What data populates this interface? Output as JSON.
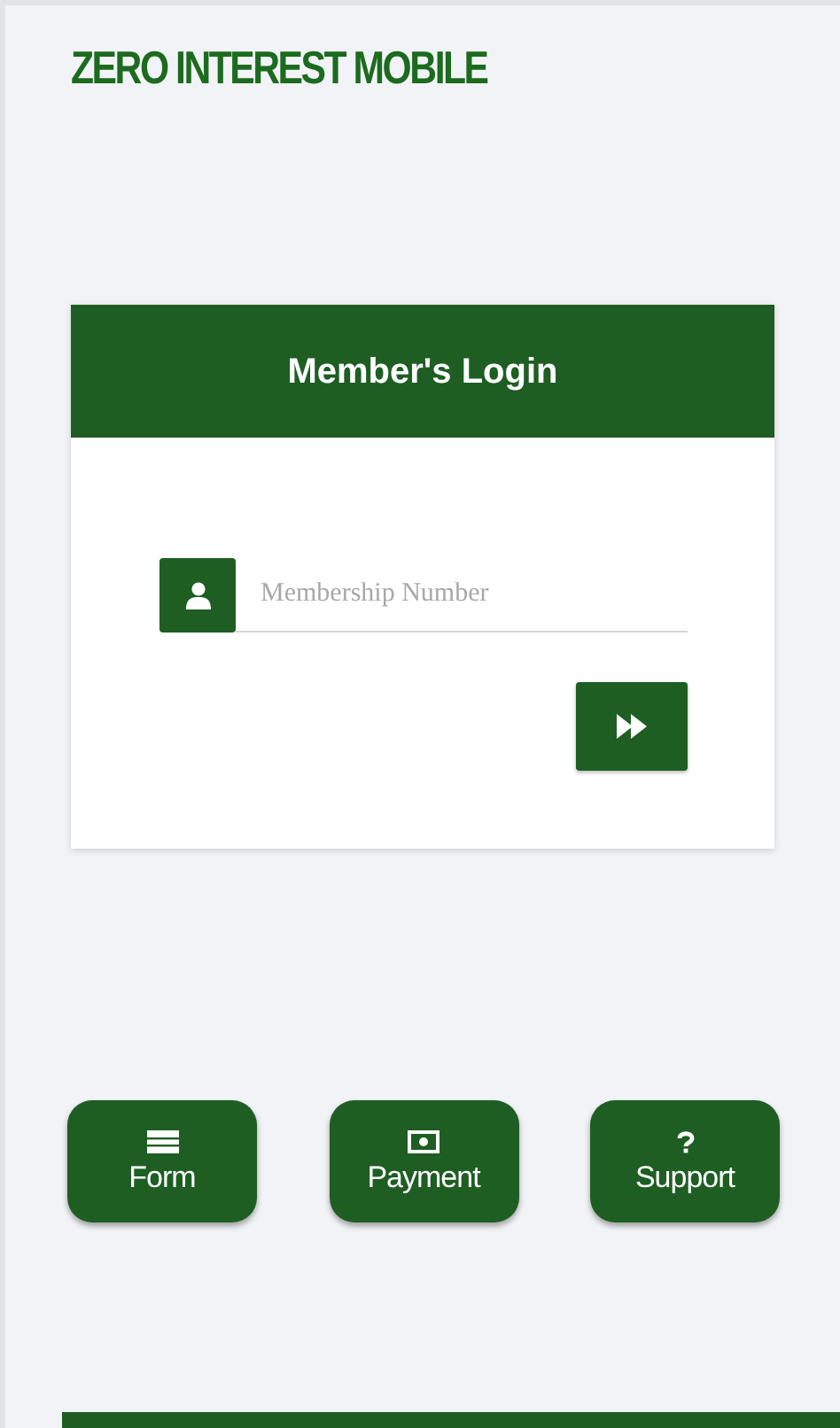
{
  "app_title": "ZERO INTEREST MOBILE",
  "login_card": {
    "title": "Member's Login",
    "membership_field": {
      "placeholder": "Membership Number"
    }
  },
  "shortcuts": [
    {
      "kind": "form",
      "label": "Form"
    },
    {
      "kind": "payment",
      "label": "Payment"
    },
    {
      "kind": "support",
      "label": "Support"
    }
  ]
}
